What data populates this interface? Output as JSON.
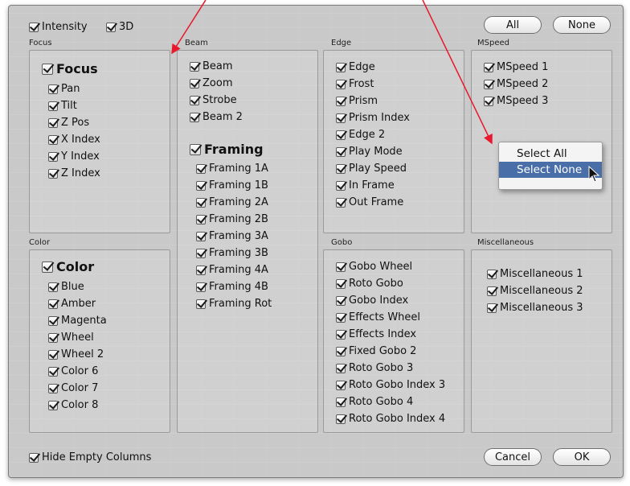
{
  "top_options": [
    {
      "label": "Intensity",
      "checked": true
    },
    {
      "label": "3D",
      "checked": true
    }
  ],
  "buttons": {
    "all": "All",
    "none": "None",
    "cancel": "Cancel",
    "ok": "OK"
  },
  "sections": {
    "focus": {
      "title": "Focus",
      "items": [
        "Focus",
        "Pan",
        "Tilt",
        "Z Pos",
        "X Index",
        "Y Index",
        "Z Index"
      ]
    },
    "beam": {
      "title": "Beam",
      "items": [
        "Beam",
        "Zoom",
        "Strobe",
        "Beam 2"
      ]
    },
    "framing": {
      "items": [
        "Framing",
        "Framing 1A",
        "Framing 1B",
        "Framing 2A",
        "Framing 2B",
        "Framing 3A",
        "Framing 3B",
        "Framing 4A",
        "Framing 4B",
        "Framing Rot"
      ]
    },
    "edge": {
      "title": "Edge",
      "items": [
        "Edge",
        "Frost",
        "Prism",
        "Prism Index",
        "Edge 2",
        "Play Mode",
        "Play Speed",
        "In Frame",
        "Out Frame"
      ]
    },
    "mspeed": {
      "title": "MSpeed",
      "items": [
        "MSpeed 1",
        "MSpeed 2",
        "MSpeed 3"
      ]
    },
    "color": {
      "title": "Color",
      "items": [
        "Color",
        "Blue",
        "Amber",
        "Magenta",
        "Wheel",
        "Wheel 2",
        "Color 6",
        "Color 7",
        "Color 8"
      ]
    },
    "gobo": {
      "title": "Gobo",
      "items": [
        "Gobo Wheel",
        "Roto Gobo",
        "Gobo Index",
        "Effects Wheel",
        "Effects Index",
        "Fixed Gobo 2",
        "Roto Gobo 3",
        "Roto Gobo Index 3",
        "Roto Gobo 4",
        "Roto Gobo Index 4"
      ]
    },
    "misc": {
      "title": "Miscellaneous",
      "items": [
        "Miscellaneous 1",
        "Miscellaneous 2",
        "Miscellaneous 3"
      ]
    }
  },
  "context_menu": {
    "items": [
      "Select All",
      "Select None"
    ],
    "highlighted": "Select None"
  },
  "hide_empty": {
    "label": "Hide Empty Columns",
    "checked": true
  },
  "colors": {
    "annotation_arrow": "#e8192c",
    "menu_highlight": "#4a6ea8"
  }
}
